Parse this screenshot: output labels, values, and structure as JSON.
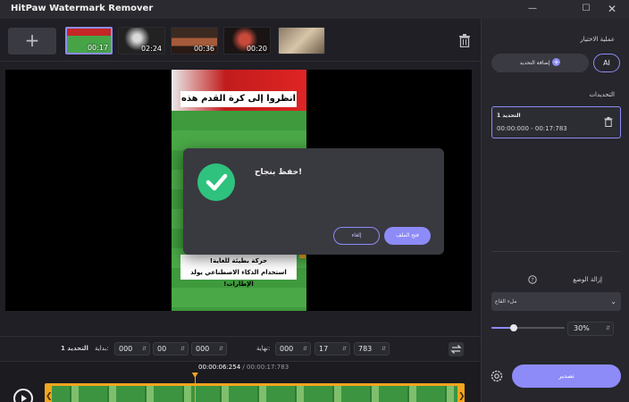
{
  "window": {
    "title": "HitPaw Watermark Remover",
    "controls": [
      "minimize",
      "maximize",
      "close"
    ]
  },
  "thumbnails": [
    {
      "time": "00:17",
      "active": true
    },
    {
      "time": "02:24",
      "active": false
    },
    {
      "time": "00:36",
      "active": false
    },
    {
      "time": "00:20",
      "active": false
    },
    {
      "time": "",
      "active": false
    }
  ],
  "add_button": "+",
  "preview": {
    "caption_top": "انظروا إلى كرة القدم هذه",
    "caption_bottom_line1": "حركة بطيئة للغاية!",
    "caption_bottom_line2": "استخدام الذكاء الاصطناعي يولد الإطارات!"
  },
  "dialog": {
    "message": "حفظ بنجاح!",
    "cancel_label": "إلغاء",
    "open_label": "فتح الملف"
  },
  "range": {
    "selection_label": "التحديد 1",
    "start_label": "بداية:",
    "start": [
      "000",
      "00",
      "000"
    ],
    "end_label": "نهاية:",
    "end": [
      "000",
      "17",
      "783"
    ]
  },
  "timeline": {
    "current": "00:00:06:254",
    "separator": " / ",
    "total": "00:00:17:783",
    "playhead_position": 0.352
  },
  "sidebar": {
    "operation_title": "عملية الاختيار",
    "add_selection_label": "إضافة التحديد",
    "ai_label": "AI",
    "selections_title": "التحديدات",
    "selections": [
      {
        "name": "التحديد 1",
        "range": "00:00:000 - 00:17:783"
      }
    ],
    "mode_title": "إزالة الوضع",
    "mode_value": "ملء القاع",
    "opacity_value": "30%",
    "opacity_level": 0.3,
    "export_label": "تصدير"
  },
  "colors": {
    "accent": "#8d8bf7",
    "timeline": "#f2a51f",
    "success": "#2ec27e"
  }
}
